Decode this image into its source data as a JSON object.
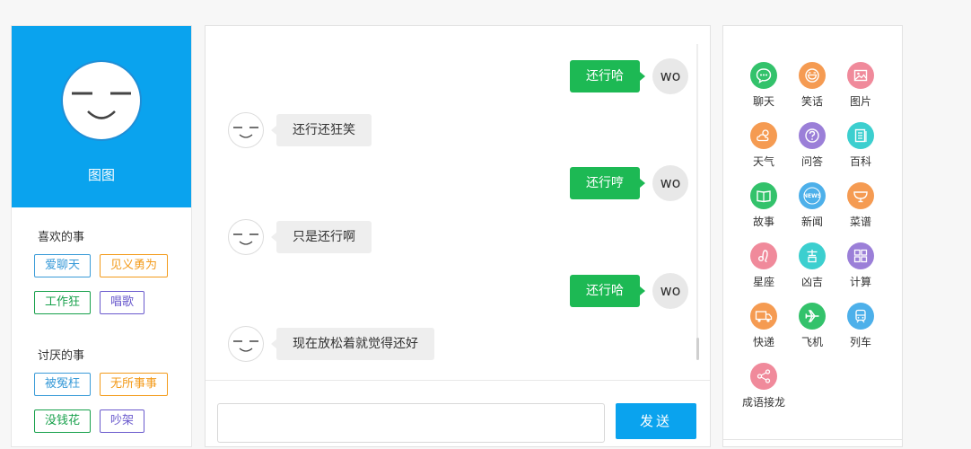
{
  "profile": {
    "name": "图图"
  },
  "likes": {
    "title": "喜欢的事",
    "tags": [
      {
        "label": "爱聊天",
        "color": "#3a9bd8"
      },
      {
        "label": "见义勇为",
        "color": "#f39b1b"
      },
      {
        "label": "工作狂",
        "color": "#16a04a"
      },
      {
        "label": "唱歌",
        "color": "#6a5acd"
      }
    ]
  },
  "dislikes": {
    "title": "讨厌的事",
    "tags": [
      {
        "label": "被冤枉",
        "color": "#3a9bd8"
      },
      {
        "label": "无所事事",
        "color": "#f39b1b"
      },
      {
        "label": "没钱花",
        "color": "#16a04a"
      },
      {
        "label": "吵架",
        "color": "#6a5acd"
      }
    ]
  },
  "chat": {
    "user_avatar": "wo",
    "messages": [
      {
        "from": "user",
        "text": "还行哈"
      },
      {
        "from": "bot",
        "text": "还行还狂笑"
      },
      {
        "from": "user",
        "text": "还行哼"
      },
      {
        "from": "bot",
        "text": "只是还行啊"
      },
      {
        "from": "user",
        "text": "还行哈"
      },
      {
        "from": "bot",
        "text": "现在放松着就觉得还好"
      }
    ],
    "input_value": "",
    "send_label": "发送"
  },
  "functions": [
    {
      "label": "聊天",
      "icon": "chat-icon",
      "color": "#33c26b"
    },
    {
      "label": "笑话",
      "icon": "smile-icon",
      "color": "#f59b52"
    },
    {
      "label": "图片",
      "icon": "picture-icon",
      "color": "#f08a9b"
    },
    {
      "label": "天气",
      "icon": "weather-icon",
      "color": "#f59b52"
    },
    {
      "label": "问答",
      "icon": "question-icon",
      "color": "#9b7fd8"
    },
    {
      "label": "百科",
      "icon": "encyclopedia-icon",
      "color": "#3ccfcf"
    },
    {
      "label": "故事",
      "icon": "book-icon",
      "color": "#33c26b"
    },
    {
      "label": "新闻",
      "icon": "news-icon",
      "color": "#4db0ea"
    },
    {
      "label": "菜谱",
      "icon": "recipe-icon",
      "color": "#f59b52"
    },
    {
      "label": "星座",
      "icon": "constellation-icon",
      "color": "#f08a9b"
    },
    {
      "label": "凶吉",
      "icon": "fortune-icon",
      "color": "#3ccfcf"
    },
    {
      "label": "计算",
      "icon": "calculator-icon",
      "color": "#9b7fd8"
    },
    {
      "label": "快递",
      "icon": "truck-icon",
      "color": "#f59b52"
    },
    {
      "label": "飞机",
      "icon": "plane-icon",
      "color": "#33c26b"
    },
    {
      "label": "列车",
      "icon": "train-icon",
      "color": "#4db0ea"
    },
    {
      "label": "成语接龙",
      "icon": "share-icon",
      "color": "#f08a9b"
    }
  ]
}
